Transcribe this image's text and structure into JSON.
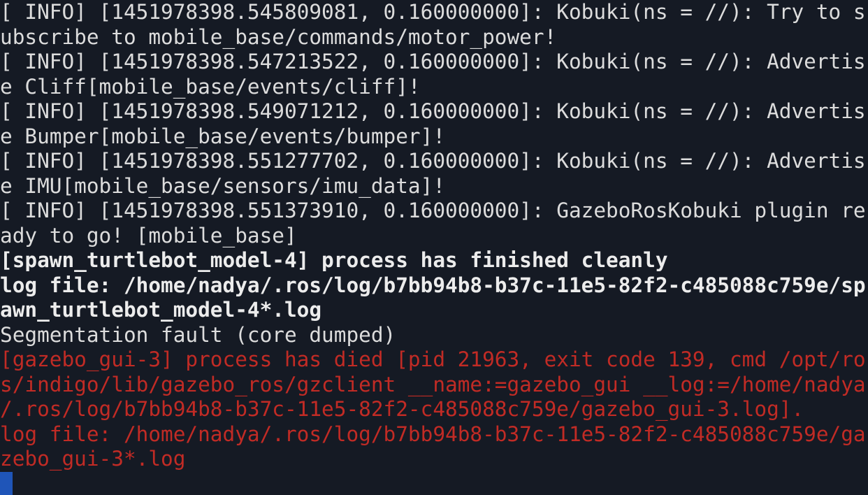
{
  "terminal": {
    "lines": [
      {
        "text": "[ INFO] [1451978398.545809081, 0.160000000]: Kobuki(ns = //): Try to s",
        "style": "normal"
      },
      {
        "text": "ubscribe to mobile_base/commands/motor_power!",
        "style": "normal"
      },
      {
        "text": "[ INFO] [1451978398.547213522, 0.160000000]: Kobuki(ns = //): Advertis",
        "style": "normal"
      },
      {
        "text": "e Cliff[mobile_base/events/cliff]!",
        "style": "normal"
      },
      {
        "text": "[ INFO] [1451978398.549071212, 0.160000000]: Kobuki(ns = //): Advertis",
        "style": "normal"
      },
      {
        "text": "e Bumper[mobile_base/events/bumper]!",
        "style": "normal"
      },
      {
        "text": "[ INFO] [1451978398.551277702, 0.160000000]: Kobuki(ns = //): Advertis",
        "style": "normal"
      },
      {
        "text": "e IMU[mobile_base/sensors/imu_data]!",
        "style": "normal"
      },
      {
        "text": "[ INFO] [1451978398.551373910, 0.160000000]: GazeboRosKobuki plugin re",
        "style": "normal"
      },
      {
        "text": "ady to go! [mobile_base]",
        "style": "normal"
      },
      {
        "text": "[spawn_turtlebot_model-4] process has finished cleanly",
        "style": "bold"
      },
      {
        "text": "log file: /home/nadya/.ros/log/b7bb94b8-b37c-11e5-82f2-c485088c759e/sp",
        "style": "bold"
      },
      {
        "text": "awn_turtlebot_model-4*.log",
        "style": "bold"
      },
      {
        "text": "Segmentation fault (core dumped)",
        "style": "normal"
      },
      {
        "text": "[gazebo_gui-3] process has died [pid 21963, exit code 139, cmd /opt/ro",
        "style": "error"
      },
      {
        "text": "s/indigo/lib/gazebo_ros/gzclient __name:=gazebo_gui __log:=/home/nadya",
        "style": "error"
      },
      {
        "text": "/.ros/log/b7bb94b8-b37c-11e5-82f2-c485088c759e/gazebo_gui-3.log].",
        "style": "error"
      },
      {
        "text": "log file: /home/nadya/.ros/log/b7bb94b8-b37c-11e5-82f2-c485088c759e/ga",
        "style": "error"
      },
      {
        "text": "zebo_gui-3*.log",
        "style": "error"
      }
    ]
  },
  "colors": {
    "background": "#151a24",
    "normal_text": "#dcdcdc",
    "bold_text": "#ececec",
    "error_text": "#c12b25",
    "cursor": "#1f55b8"
  }
}
